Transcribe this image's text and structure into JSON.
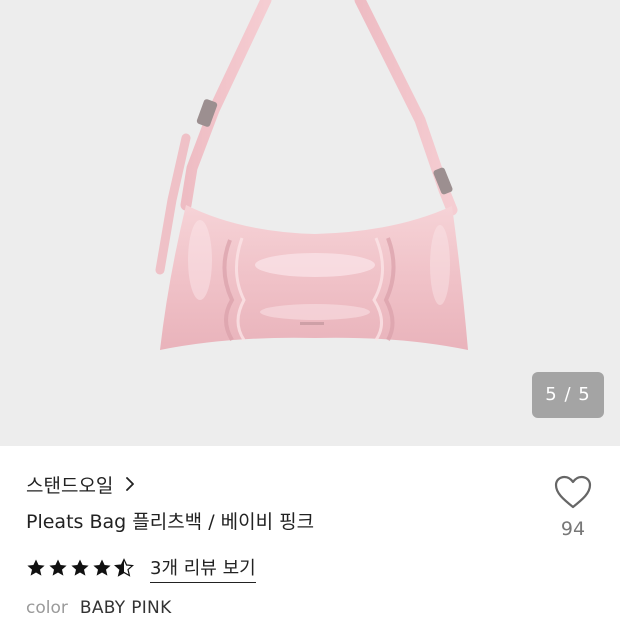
{
  "gallery": {
    "counter": "5 / 5",
    "image_alt": "product-photo",
    "product_color": "#f2c7cc",
    "background": "#ededed"
  },
  "product": {
    "brand": "스탠드오일",
    "title": "Pleats Bag 플리츠백 / 베이비 핑크",
    "rating": 4.5,
    "review_link": "3개 리뷰 보기",
    "color_label": "color",
    "color_value": "BABY PINK"
  },
  "wishlist": {
    "count": "94",
    "icon": "heart-outline-icon"
  },
  "icons": {
    "brand_chevron": "chevron-right-icon",
    "star": "star-icon"
  }
}
